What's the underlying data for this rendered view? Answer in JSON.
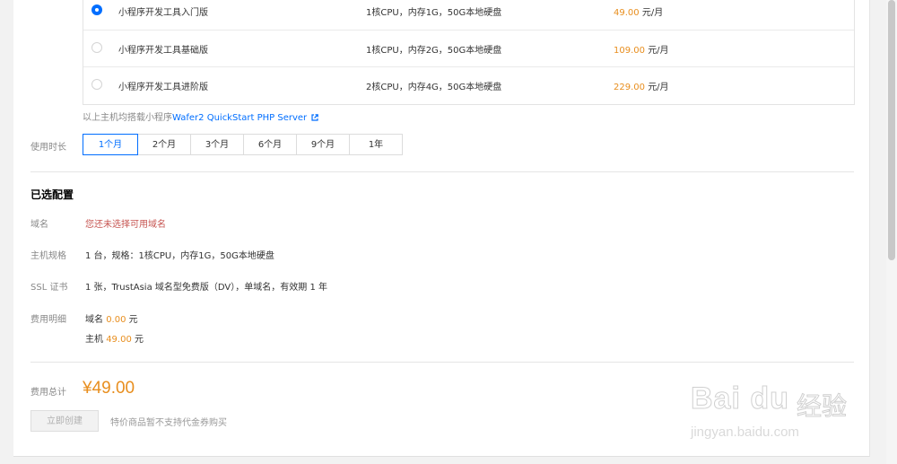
{
  "plans": [
    {
      "name": "小程序开发工具入门版",
      "spec": "1核CPU，内存1G，50G本地硬盘",
      "price": "49.00",
      "unit": "元/月",
      "selected": true
    },
    {
      "name": "小程序开发工具基础版",
      "spec": "1核CPU，内存2G，50G本地硬盘",
      "price": "109.00",
      "unit": "元/月",
      "selected": false
    },
    {
      "name": "小程序开发工具进阶版",
      "spec": "2核CPU，内存4G，50G本地硬盘",
      "price": "229.00",
      "unit": "元/月",
      "selected": false
    }
  ],
  "note": {
    "prefix": "以上主机均搭载小程序",
    "link": "Wafer2 QuickStart PHP Server"
  },
  "duration": {
    "label": "使用时长",
    "options": [
      "1个月",
      "2个月",
      "3个月",
      "6个月",
      "9个月",
      "1年"
    ],
    "selected": "1个月"
  },
  "summary": {
    "title": "已选配置",
    "domain_label": "域名",
    "domain_value": "您还未选择可用域名",
    "host_label": "主机规格",
    "host_value": "1 台，规格：1核CPU，内存1G，50G本地硬盘",
    "ssl_label": "SSL 证书",
    "ssl_value": "1 张，TrustAsia 域名型免费版（DV），单域名，有效期 1 年",
    "cost_label": "费用明细",
    "cost_domain_prefix": "域名",
    "cost_domain_amount": "0.00",
    "cost_host_prefix": "主机",
    "cost_host_amount": "49.00",
    "currency_unit": "元"
  },
  "total": {
    "label": "费用总计",
    "amount": "¥49.00",
    "create_button": "立即创建",
    "tip": "特价商品暂不支持代金券购买"
  },
  "watermark": {
    "brand": "Bai du",
    "cn": "经验",
    "url": "jingyan.baidu.com"
  },
  "colors": {
    "accent": "#006eff",
    "price": "#e88e1e",
    "warning": "#c65450"
  }
}
